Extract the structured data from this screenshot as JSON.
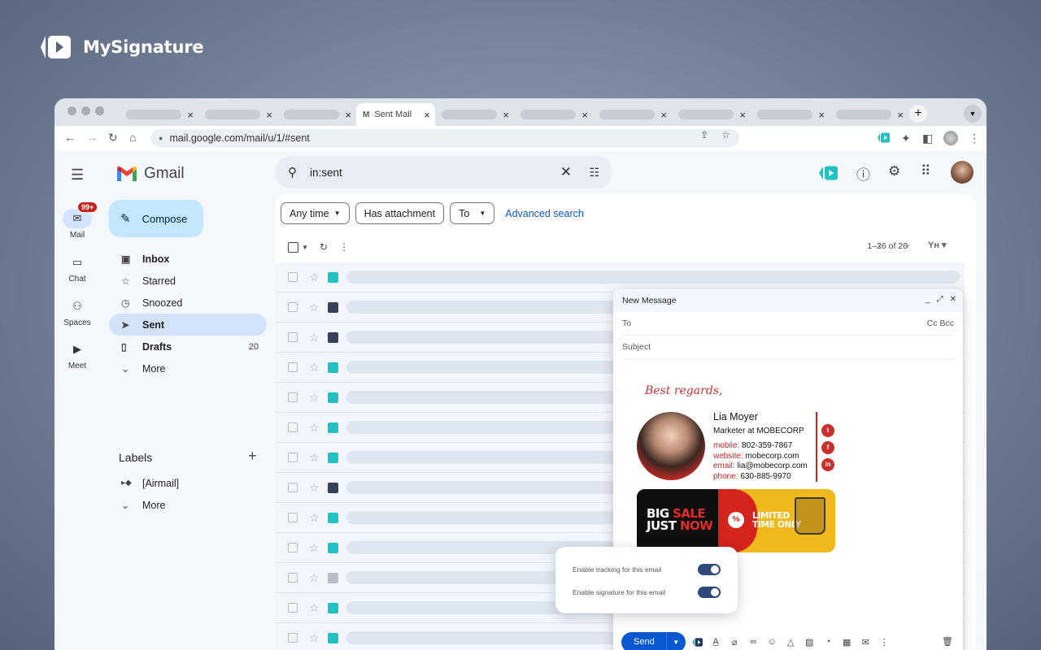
{
  "brand": {
    "name": "MySignature"
  },
  "browser": {
    "tabs": [
      {
        "label": "",
        "active": false
      },
      {
        "label": "",
        "active": false
      },
      {
        "label": "",
        "active": false
      },
      {
        "label": "Sent Mail",
        "active": true
      },
      {
        "label": "",
        "active": false
      },
      {
        "label": "",
        "active": false
      },
      {
        "label": "",
        "active": false
      },
      {
        "label": "",
        "active": false
      },
      {
        "label": "",
        "active": false
      },
      {
        "label": "",
        "active": false
      }
    ],
    "tab_close": "×",
    "new_tab": "+",
    "url": "mail.google.com/mail/u/1/#sent"
  },
  "gmail": {
    "logo_text": "Gmail",
    "rail": [
      {
        "label": "Mail",
        "icon": "mail-icon",
        "badge": "99+"
      },
      {
        "label": "Chat",
        "icon": "chat-icon"
      },
      {
        "label": "Spaces",
        "icon": "spaces-icon"
      },
      {
        "label": "Meet",
        "icon": "meet-icon"
      }
    ],
    "compose_label": "Compose",
    "nav": [
      {
        "label": "Inbox",
        "icon": "inbox-icon",
        "bold": true,
        "count": ""
      },
      {
        "label": "Starred",
        "icon": "star-icon",
        "bold": false,
        "count": ""
      },
      {
        "label": "Snoozed",
        "icon": "clock-icon",
        "bold": false,
        "count": ""
      },
      {
        "label": "Sent",
        "icon": "send-icon",
        "bold": true,
        "count": ""
      },
      {
        "label": "Drafts",
        "icon": "draft-icon",
        "bold": true,
        "count": "20"
      },
      {
        "label": "More",
        "icon": "chevron-down-icon",
        "bold": false,
        "count": ""
      }
    ],
    "labels_heading": "Labels",
    "labels": [
      {
        "label": "[Airmail]"
      },
      {
        "label": "More"
      }
    ],
    "search_value": "in:sent",
    "filters": {
      "any_time": "Any time",
      "has_attachment": "Has attachment",
      "to": "To",
      "advanced": "Advanced search"
    },
    "pagination": "1–26 of 26",
    "rows": 13
  },
  "compose_window": {
    "title": "New Message",
    "to_label": "To",
    "cc_bcc": "Cc Bcc",
    "subject_label": "Subject",
    "send_label": "Send"
  },
  "signature": {
    "closing": "Best regards,",
    "name": "Lia Moyer",
    "role": "Marketer at MOBECORP",
    "mobile_key": "mobile:",
    "mobile": "802-359-7867",
    "website_key": "website:",
    "website": "mobecorp.com",
    "email_key": "email:",
    "email": "lia@mobecorp.com",
    "phone_key": "phone:",
    "phone": "630-885-9970",
    "banner_line1_a": "BIG",
    "banner_line1_b": "SALE",
    "banner_line2_a": "JUST",
    "banner_line2_b": "NOW",
    "banner_pct": "%",
    "banner_right_1": "LIMITED",
    "banner_right_2": "TIME ONLY"
  },
  "popover": {
    "tracking": "Enable tracking for this email",
    "signature": "Enable signature for this email",
    "tracking_on": true,
    "signature_on": true
  },
  "colors": {
    "accent": "#0b57d0",
    "signature_red": "#c8302c",
    "brand_teal": "#1fc2c0"
  }
}
